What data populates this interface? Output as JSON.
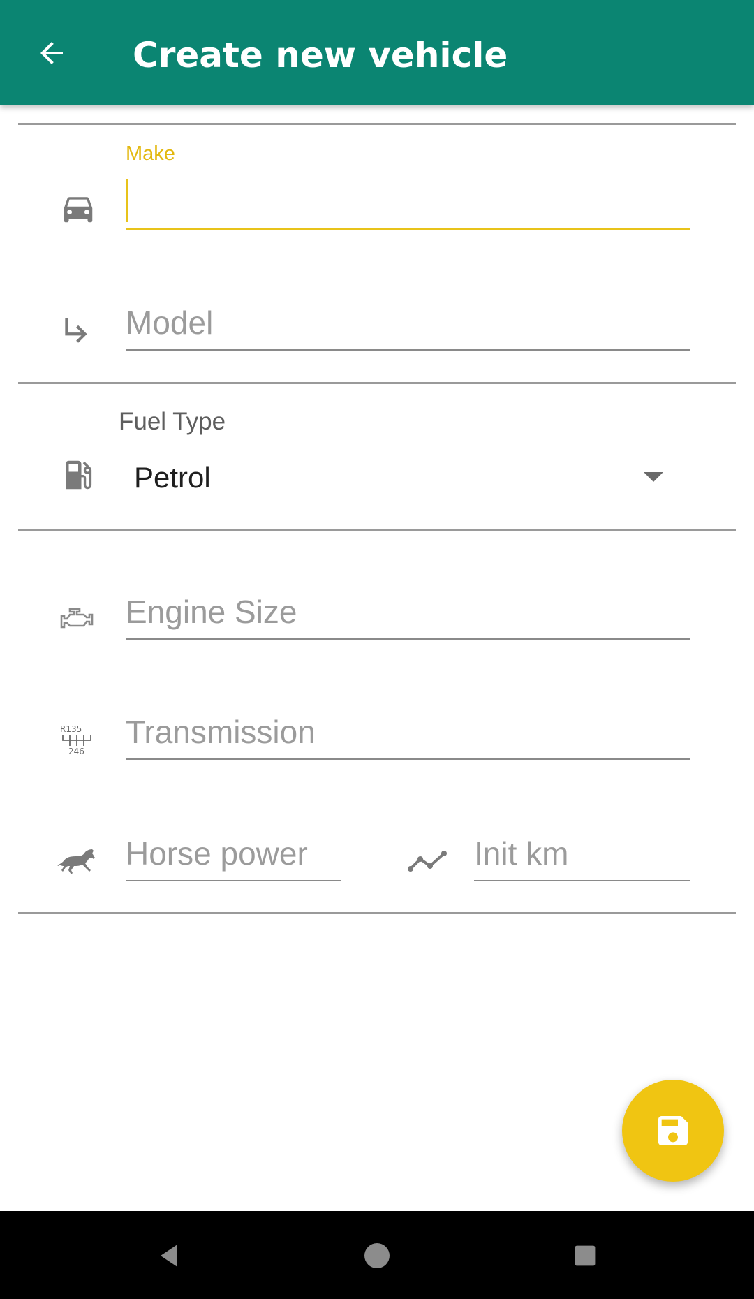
{
  "appbar": {
    "title": "Create new vehicle",
    "back_icon": "arrow-back-icon",
    "background_color": "#0b8572"
  },
  "form": {
    "make": {
      "label": "Make",
      "value": "",
      "icon": "car-icon",
      "focused": true,
      "accent_color": "#e8c31a"
    },
    "model": {
      "placeholder": "Model",
      "value": "",
      "icon": "subdirectory-arrow-icon"
    },
    "fuel_type": {
      "label": "Fuel Type",
      "selected": "Petrol",
      "icon": "gas-station-icon"
    },
    "engine_size": {
      "placeholder": "Engine Size",
      "value": "",
      "icon": "engine-icon"
    },
    "transmission": {
      "placeholder": "Transmission",
      "value": "",
      "icon": "gearbox-icon",
      "icon_text_top": "R135",
      "icon_text_bottom": "246"
    },
    "horse_power": {
      "placeholder": "Horse power",
      "value": "",
      "icon": "horse-icon"
    },
    "init_km": {
      "placeholder": "Init km",
      "value": "",
      "icon": "trending-line-icon"
    }
  },
  "fab": {
    "icon": "save-floppy-icon",
    "color": "#f0c512"
  },
  "navbar": {
    "back": "nav-back-icon",
    "home": "nav-home-icon",
    "recents": "nav-recents-icon"
  }
}
